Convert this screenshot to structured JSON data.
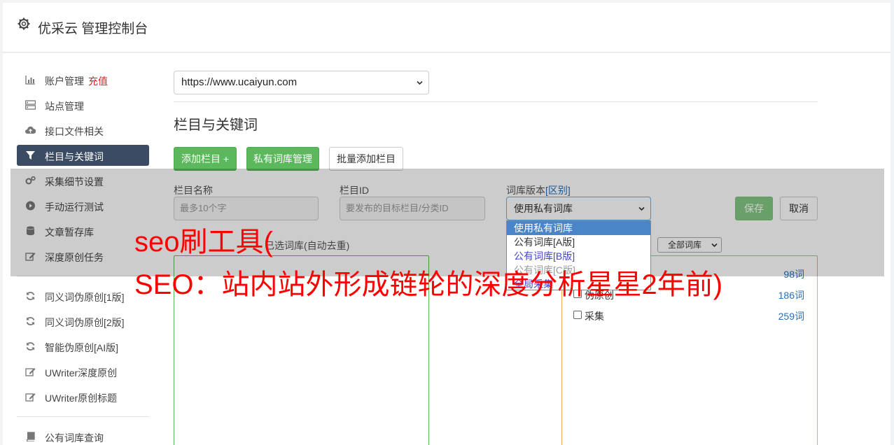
{
  "header": {
    "title": "优采云 管理控制台",
    "icon": "gear-icon"
  },
  "sidebar": {
    "items": [
      {
        "label": "账户管理",
        "extra": "充值",
        "icon": "bar-chart-icon"
      },
      {
        "label": "站点管理",
        "icon": "server-icon"
      },
      {
        "label": "接口文件相关",
        "icon": "cloud-upload-icon"
      },
      {
        "label": "栏目与关键词",
        "icon": "filter-icon",
        "active": true
      },
      {
        "label": "采集细节设置",
        "icon": "cogs-icon"
      },
      {
        "label": "手动运行测试",
        "icon": "play-circle-icon"
      },
      {
        "label": "文章暂存库",
        "icon": "database-icon"
      },
      {
        "label": "深度原创任务",
        "icon": "edit-icon"
      },
      {
        "label": "同义词伪原创[1版]",
        "icon": "refresh-icon"
      },
      {
        "label": "同义词伪原创[2版]",
        "icon": "refresh-icon"
      },
      {
        "label": "智能伪原创[AI版]",
        "icon": "refresh-icon"
      },
      {
        "label": "UWriter深度原创",
        "icon": "edit-icon"
      },
      {
        "label": "UWriter原创标题",
        "icon": "edit-icon"
      },
      {
        "label": "公有词库查询",
        "icon": "book-icon"
      }
    ]
  },
  "main": {
    "site_select": "https://www.ucaiyun.com",
    "section_title": "栏目与关键词",
    "buttons": {
      "add_column": "添加栏目 +",
      "private_lib": "私有词库管理",
      "batch_add": "批量添加栏目"
    },
    "form": {
      "name_label": "栏目名称",
      "name_placeholder": "最多10个字",
      "id_label": "栏目ID",
      "id_placeholder": "要发布的目标栏目/分类ID",
      "version_label": "词库版本",
      "version_link": "[区别]",
      "version_value": "使用私有词库",
      "save": "保存",
      "cancel": "取消"
    },
    "dropdown_options": [
      "使用私有词库",
      "公有词库[A版]",
      "公有词库[B版]",
      "公有词库[C版]",
      "全局采集"
    ],
    "selected_words_label": "已选词库(自动去重)",
    "filter_select": "全部词库",
    "libraries": [
      {
        "name": "采集",
        "count": "98词"
      },
      {
        "name": "伪原创",
        "count": "186词"
      },
      {
        "name": "采集",
        "count": "259词"
      }
    ]
  },
  "watermark": {
    "line1": "seo刷工具(",
    "line2": "SEO：站内站外形成链轮的深度分析星星2年前)"
  }
}
